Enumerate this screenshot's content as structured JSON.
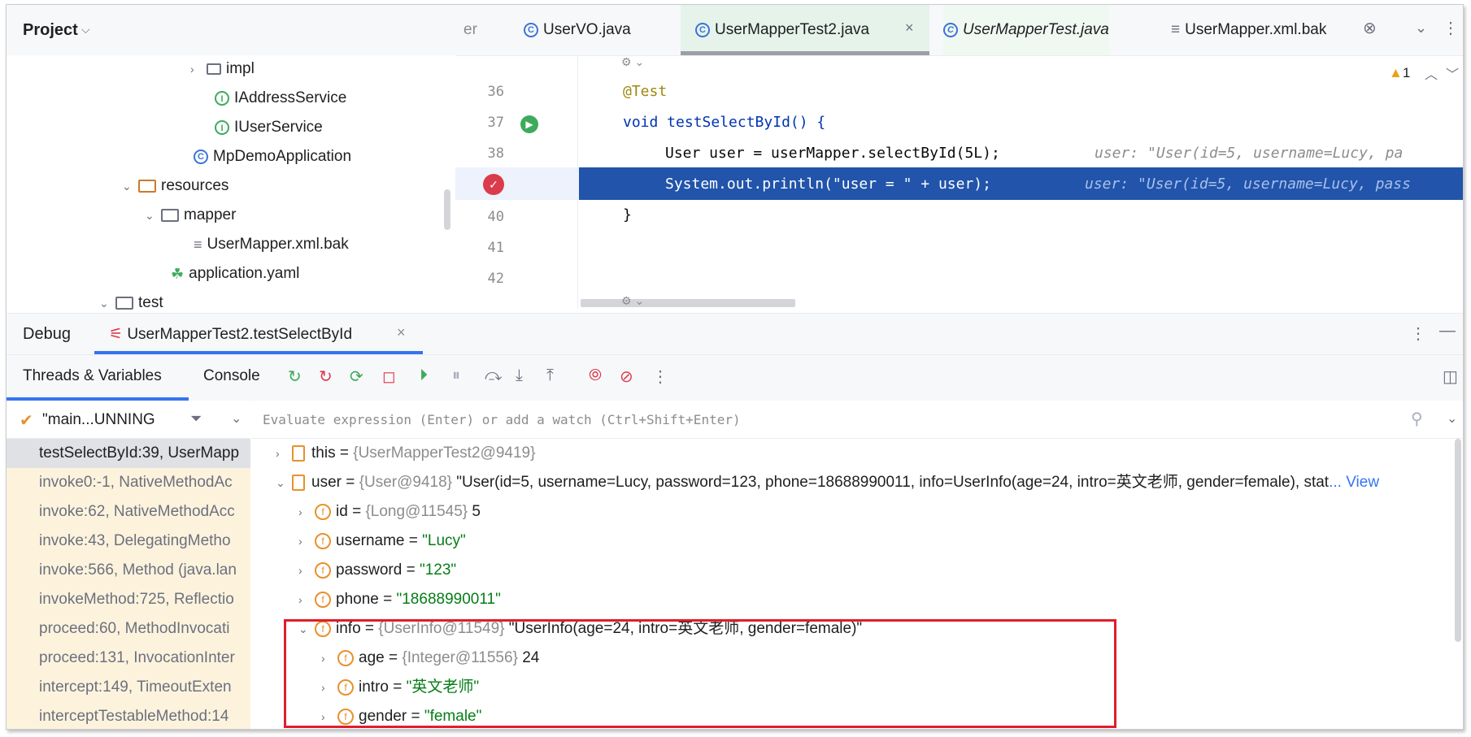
{
  "project": {
    "title": "Project",
    "tree": [
      {
        "label": "impl",
        "kind": "folder-pkg"
      },
      {
        "label": "IAddressService",
        "kind": "interface"
      },
      {
        "label": "IUserService",
        "kind": "interface"
      },
      {
        "label": "MpDemoApplication",
        "kind": "class"
      },
      {
        "label": "resources",
        "kind": "folder"
      },
      {
        "label": "mapper",
        "kind": "folder"
      },
      {
        "label": "UserMapper.xml.bak",
        "kind": "file"
      },
      {
        "label": "application.yaml",
        "kind": "yaml"
      },
      {
        "label": "test",
        "kind": "folder"
      }
    ]
  },
  "editor_tabs": [
    {
      "label": "er"
    },
    {
      "label": "UserVO.java"
    },
    {
      "label": "UserMapperTest2.java",
      "active": true
    },
    {
      "label": "UserMapperTest.java"
    },
    {
      "label": "UserMapper.xml.bak"
    }
  ],
  "editor": {
    "warning_count": "1",
    "lines": [
      {
        "no": "36",
        "code": "@Test"
      },
      {
        "no": "37",
        "code": "void testSelectById() {"
      },
      {
        "no": "38",
        "code": "User user = userMapper.selectById(5L);",
        "inlay": "user: \"User(id=5, username=Lucy, pa"
      },
      {
        "no": "",
        "code": "System.out.println(\"user = \" + user);",
        "inlay": "user: \"User(id=5, username=Lucy, pass"
      },
      {
        "no": "40",
        "code": "}"
      },
      {
        "no": "41",
        "code": ""
      },
      {
        "no": "42",
        "code": ""
      }
    ]
  },
  "debug": {
    "title": "Debug",
    "session": "UserMapperTest2.testSelectById",
    "tabs": [
      "Threads & Variables",
      "Console"
    ],
    "thread": "\"main...UNNING",
    "evaluate_placeholder": "Evaluate expression (Enter) or add a watch (Ctrl+Shift+Enter)",
    "frames": [
      "testSelectById:39, UserMapp",
      "invoke0:-1, NativeMethodAc",
      "invoke:62, NativeMethodAcc",
      "invoke:43, DelegatingMetho",
      "invoke:566, Method (java.lan",
      "invokeMethod:725, Reflectio",
      "proceed:60, MethodInvocati",
      "proceed:131, InvocationInter",
      "intercept:149, TimeoutExten",
      "interceptTestableMethod:14"
    ],
    "variables": [
      {
        "name": "this",
        "ref": "{UserMapperTest2@9419}",
        "value": ""
      },
      {
        "name": "user",
        "ref": "{User@9418}",
        "value": "\"User(id=5, username=Lucy, password=123, phone=18688990011, info=UserInfo(age=24, intro=英文老师, gender=female), stat",
        "link": "... View"
      },
      {
        "name": "id",
        "ref": "{Long@11545}",
        "value": "5"
      },
      {
        "name": "username",
        "ref": "",
        "value": "\"Lucy\""
      },
      {
        "name": "password",
        "ref": "",
        "value": "\"123\""
      },
      {
        "name": "phone",
        "ref": "",
        "value": "\"18688990011\""
      },
      {
        "name": "info",
        "ref": "{UserInfo@11549}",
        "value": "\"UserInfo(age=24, intro=英文老师, gender=female)\""
      },
      {
        "name": "age",
        "ref": "{Integer@11556}",
        "value": "24"
      },
      {
        "name": "intro",
        "ref": "",
        "value": "\"英文老师\""
      },
      {
        "name": "gender",
        "ref": "",
        "value": "\"female\""
      }
    ]
  },
  "colors": {
    "accent": "#3574f0",
    "highlight": "#2154aa",
    "breakpoint": "#db3b4b",
    "annotation": "#e11d2b"
  }
}
